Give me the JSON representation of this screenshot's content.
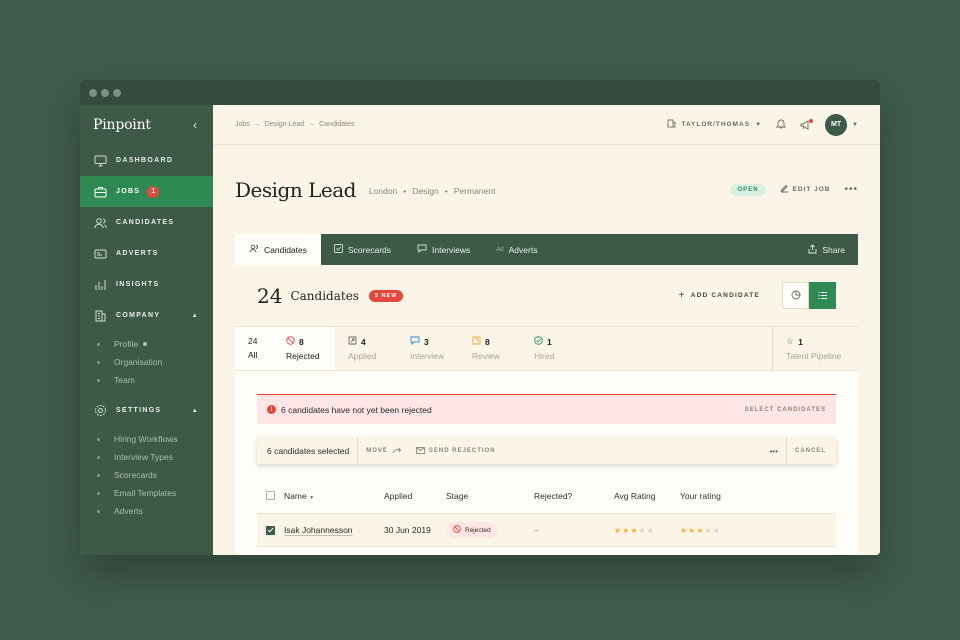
{
  "brand": "Pinpoint",
  "sidebar": {
    "items": [
      {
        "label": "DASHBOARD"
      },
      {
        "label": "JOBS",
        "badge": "1"
      },
      {
        "label": "CANDIDATES"
      },
      {
        "label": "ADVERTS"
      },
      {
        "label": "INSIGHTS"
      },
      {
        "label": "COMPANY"
      },
      {
        "label": "SETTINGS"
      }
    ],
    "company_sub": [
      "Profile",
      "Organisation",
      "Team"
    ],
    "settings_sub": [
      "Hiring Workflows",
      "Interview Types",
      "Scorecards",
      "Email Templates",
      "Adverts"
    ]
  },
  "topbar": {
    "crumbs": [
      "Jobs",
      "→",
      "Design Lead",
      "→",
      "Candidates"
    ],
    "org": "TAYLOR/THOMAS",
    "avatar": "MT"
  },
  "job": {
    "title": "Design Lead",
    "meta": [
      "London",
      "•",
      "Design",
      "•",
      "Permanent"
    ],
    "status": "OPEN",
    "edit_label": "EDIT JOB",
    "more": "•••"
  },
  "tabs": [
    {
      "label": "Candidates"
    },
    {
      "label": "Scorecards"
    },
    {
      "label": "Interviews"
    },
    {
      "label": "Adverts",
      "prefix": "Ad"
    },
    {
      "label": "Share"
    }
  ],
  "candidates_head": {
    "count": "24",
    "label": "Candidates",
    "new_badge": "5 NEW",
    "add_label": "ADD CANDIDATE"
  },
  "stages": [
    {
      "count": "24",
      "label": "All"
    },
    {
      "count": "8",
      "label": "Rejected"
    },
    {
      "count": "4",
      "label": "Applied"
    },
    {
      "count": "3",
      "label": "Interview"
    },
    {
      "count": "8",
      "label": "Review"
    },
    {
      "count": "1",
      "label": "Hired"
    },
    {
      "count": "1",
      "label": "Talent Pipeline"
    }
  ],
  "alert": {
    "icon": "!",
    "text": "6 candidates have not yet been rejected",
    "action": "SELECT CANDIDATES"
  },
  "bulk": {
    "selected": "6 candidates selected",
    "move": "MOVE",
    "send_rejection": "SEND REJECTION",
    "more": "•••",
    "cancel": "CANCEL"
  },
  "table": {
    "headers": [
      "Name",
      "Applied",
      "Stage",
      "Rejected?",
      "Avg Rating",
      "Your rating"
    ],
    "rows": [
      {
        "name": "Isak Johannesson",
        "applied": "30 Jun 2019",
        "stage": "Rejected",
        "rejected": "–",
        "avg_rating": 3,
        "your_rating": 3,
        "checked": true
      }
    ]
  },
  "colors": {
    "background": "#3f5b4b",
    "sidebar": "#3d5a48",
    "accent_green": "#2e8a52",
    "alert_red": "#e5473e",
    "page": "#faf5e6",
    "star": "#f3b33d"
  }
}
